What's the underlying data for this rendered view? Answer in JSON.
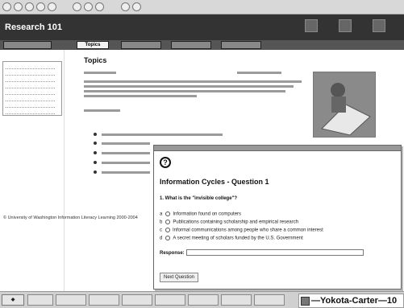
{
  "app": {
    "title": "Research 101"
  },
  "tabs": {
    "active_label": "Topics"
  },
  "main": {
    "title": "Topics"
  },
  "sidebar": {
    "copyright": "© University of Washington Information Literacy Learning 2000-2004"
  },
  "popup": {
    "title": "Information Cycles - Question 1",
    "question": "1. What is the \"invisible college\"?",
    "choices": [
      {
        "letter": "a",
        "text": "Information found on computers"
      },
      {
        "letter": "b",
        "text": "Publications containing scholarship and empirical research"
      },
      {
        "letter": "c",
        "text": "Informal communications among people who share a common interest"
      },
      {
        "letter": "d",
        "text": "A secret meeting of scholars funded by the U.S. Government"
      }
    ],
    "response_label": "Response:",
    "next_label": "Next Question"
  },
  "watermark": {
    "text": "—Yokota-Carter—10"
  }
}
